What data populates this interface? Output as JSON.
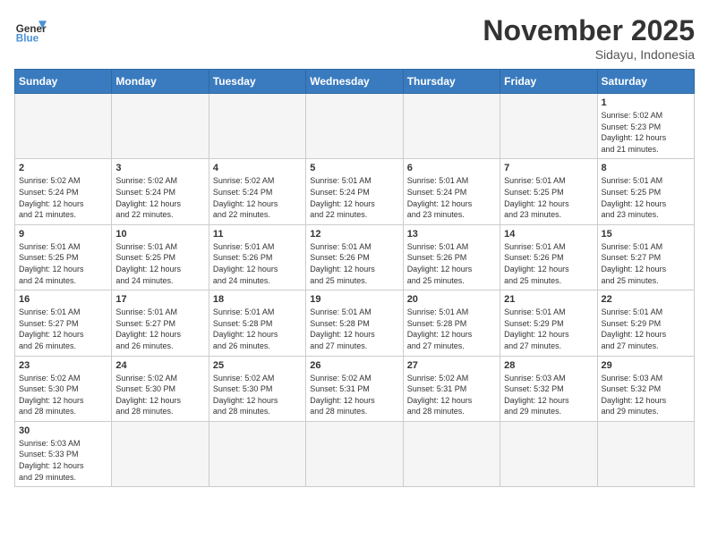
{
  "header": {
    "logo_general": "General",
    "logo_blue": "Blue",
    "month_title": "November 2025",
    "subtitle": "Sidayu, Indonesia"
  },
  "weekdays": [
    "Sunday",
    "Monday",
    "Tuesday",
    "Wednesday",
    "Thursday",
    "Friday",
    "Saturday"
  ],
  "days": [
    {
      "num": "",
      "info": ""
    },
    {
      "num": "",
      "info": ""
    },
    {
      "num": "",
      "info": ""
    },
    {
      "num": "",
      "info": ""
    },
    {
      "num": "",
      "info": ""
    },
    {
      "num": "",
      "info": ""
    },
    {
      "num": "1",
      "info": "Sunrise: 5:02 AM\nSunset: 5:23 PM\nDaylight: 12 hours\nand 21 minutes."
    },
    {
      "num": "2",
      "info": "Sunrise: 5:02 AM\nSunset: 5:24 PM\nDaylight: 12 hours\nand 21 minutes."
    },
    {
      "num": "3",
      "info": "Sunrise: 5:02 AM\nSunset: 5:24 PM\nDaylight: 12 hours\nand 22 minutes."
    },
    {
      "num": "4",
      "info": "Sunrise: 5:02 AM\nSunset: 5:24 PM\nDaylight: 12 hours\nand 22 minutes."
    },
    {
      "num": "5",
      "info": "Sunrise: 5:01 AM\nSunset: 5:24 PM\nDaylight: 12 hours\nand 22 minutes."
    },
    {
      "num": "6",
      "info": "Sunrise: 5:01 AM\nSunset: 5:24 PM\nDaylight: 12 hours\nand 23 minutes."
    },
    {
      "num": "7",
      "info": "Sunrise: 5:01 AM\nSunset: 5:25 PM\nDaylight: 12 hours\nand 23 minutes."
    },
    {
      "num": "8",
      "info": "Sunrise: 5:01 AM\nSunset: 5:25 PM\nDaylight: 12 hours\nand 23 minutes."
    },
    {
      "num": "9",
      "info": "Sunrise: 5:01 AM\nSunset: 5:25 PM\nDaylight: 12 hours\nand 24 minutes."
    },
    {
      "num": "10",
      "info": "Sunrise: 5:01 AM\nSunset: 5:25 PM\nDaylight: 12 hours\nand 24 minutes."
    },
    {
      "num": "11",
      "info": "Sunrise: 5:01 AM\nSunset: 5:26 PM\nDaylight: 12 hours\nand 24 minutes."
    },
    {
      "num": "12",
      "info": "Sunrise: 5:01 AM\nSunset: 5:26 PM\nDaylight: 12 hours\nand 25 minutes."
    },
    {
      "num": "13",
      "info": "Sunrise: 5:01 AM\nSunset: 5:26 PM\nDaylight: 12 hours\nand 25 minutes."
    },
    {
      "num": "14",
      "info": "Sunrise: 5:01 AM\nSunset: 5:26 PM\nDaylight: 12 hours\nand 25 minutes."
    },
    {
      "num": "15",
      "info": "Sunrise: 5:01 AM\nSunset: 5:27 PM\nDaylight: 12 hours\nand 25 minutes."
    },
    {
      "num": "16",
      "info": "Sunrise: 5:01 AM\nSunset: 5:27 PM\nDaylight: 12 hours\nand 26 minutes."
    },
    {
      "num": "17",
      "info": "Sunrise: 5:01 AM\nSunset: 5:27 PM\nDaylight: 12 hours\nand 26 minutes."
    },
    {
      "num": "18",
      "info": "Sunrise: 5:01 AM\nSunset: 5:28 PM\nDaylight: 12 hours\nand 26 minutes."
    },
    {
      "num": "19",
      "info": "Sunrise: 5:01 AM\nSunset: 5:28 PM\nDaylight: 12 hours\nand 27 minutes."
    },
    {
      "num": "20",
      "info": "Sunrise: 5:01 AM\nSunset: 5:28 PM\nDaylight: 12 hours\nand 27 minutes."
    },
    {
      "num": "21",
      "info": "Sunrise: 5:01 AM\nSunset: 5:29 PM\nDaylight: 12 hours\nand 27 minutes."
    },
    {
      "num": "22",
      "info": "Sunrise: 5:01 AM\nSunset: 5:29 PM\nDaylight: 12 hours\nand 27 minutes."
    },
    {
      "num": "23",
      "info": "Sunrise: 5:02 AM\nSunset: 5:30 PM\nDaylight: 12 hours\nand 28 minutes."
    },
    {
      "num": "24",
      "info": "Sunrise: 5:02 AM\nSunset: 5:30 PM\nDaylight: 12 hours\nand 28 minutes."
    },
    {
      "num": "25",
      "info": "Sunrise: 5:02 AM\nSunset: 5:30 PM\nDaylight: 12 hours\nand 28 minutes."
    },
    {
      "num": "26",
      "info": "Sunrise: 5:02 AM\nSunset: 5:31 PM\nDaylight: 12 hours\nand 28 minutes."
    },
    {
      "num": "27",
      "info": "Sunrise: 5:02 AM\nSunset: 5:31 PM\nDaylight: 12 hours\nand 28 minutes."
    },
    {
      "num": "28",
      "info": "Sunrise: 5:03 AM\nSunset: 5:32 PM\nDaylight: 12 hours\nand 29 minutes."
    },
    {
      "num": "29",
      "info": "Sunrise: 5:03 AM\nSunset: 5:32 PM\nDaylight: 12 hours\nand 29 minutes."
    },
    {
      "num": "30",
      "info": "Sunrise: 5:03 AM\nSunset: 5:33 PM\nDaylight: 12 hours\nand 29 minutes."
    },
    {
      "num": "",
      "info": ""
    },
    {
      "num": "",
      "info": ""
    },
    {
      "num": "",
      "info": ""
    },
    {
      "num": "",
      "info": ""
    },
    {
      "num": "",
      "info": ""
    },
    {
      "num": "",
      "info": ""
    }
  ]
}
